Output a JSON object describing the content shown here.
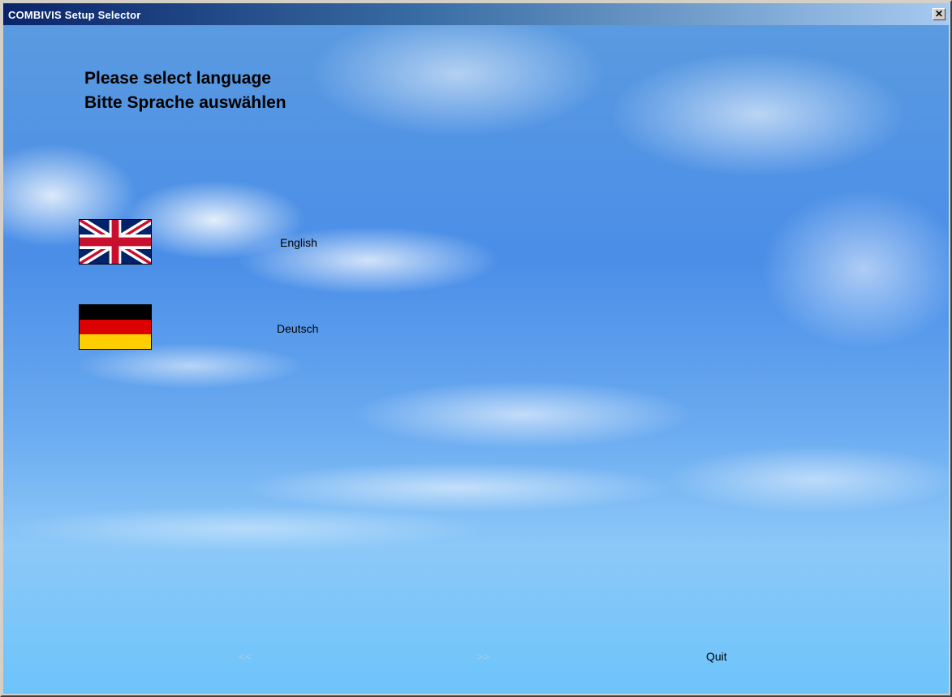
{
  "window": {
    "title": "COMBIVIS Setup Selector",
    "close_glyph": "✕"
  },
  "heading": {
    "line1": "Please select language",
    "line2": "Bitte Sprache auswählen"
  },
  "languages": [
    {
      "label": "English",
      "flag_icon": "uk-flag-icon"
    },
    {
      "label": "Deutsch",
      "flag_icon": "germany-flag-icon"
    }
  ],
  "nav": {
    "prev_label": "<<",
    "next_label": ">>",
    "quit_label": "Quit",
    "prev_enabled": false,
    "next_enabled": false
  },
  "colors": {
    "titlebar_start": "#0a246a",
    "titlebar_end": "#a6caf0",
    "disabled_text": "#a8cce6"
  }
}
